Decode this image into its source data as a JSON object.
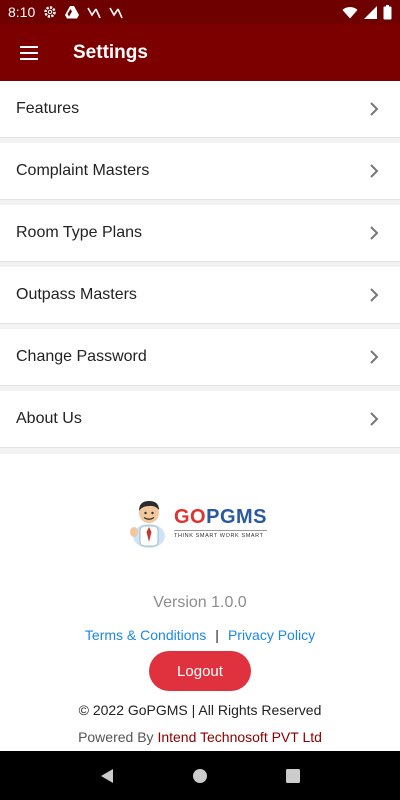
{
  "status_bar": {
    "time": "8:10"
  },
  "app_bar": {
    "title": "Settings"
  },
  "settings": {
    "items": [
      {
        "label": "Features"
      },
      {
        "label": "Complaint Masters"
      },
      {
        "label": "Room Type Plans"
      },
      {
        "label": "Outpass Masters"
      },
      {
        "label": "Change Password"
      },
      {
        "label": "About Us"
      }
    ]
  },
  "footer": {
    "logo": {
      "go": "GO",
      "pgms": "PGMS",
      "tagline": "THINK SMART WORK SMART"
    },
    "version": "Version 1.0.0",
    "terms_label": "Terms & Conditions",
    "separator": "|",
    "privacy_label": "Privacy Policy",
    "logout_label": "Logout",
    "copyright": "© 2022 GoPGMS | All Rights Reserved",
    "powered_by_prefix": "Powered By",
    "powered_by_company": "Intend Technosoft PVT Ltd"
  },
  "colors": {
    "app_bar": "#7d0000",
    "status_bar": "#6e0000",
    "link": "#1e88e5",
    "logout": "#e0323e",
    "company": "#8a0000"
  },
  "icons": {
    "status": [
      "gear-icon",
      "drive-icon",
      "missed-call-icon",
      "missed-call-icon",
      "wifi-icon",
      "signal-icon",
      "battery-icon"
    ],
    "menu": "hamburger-menu-icon",
    "row": "chevron-right-icon",
    "nav": [
      "back-icon",
      "home-icon",
      "recents-icon"
    ]
  }
}
